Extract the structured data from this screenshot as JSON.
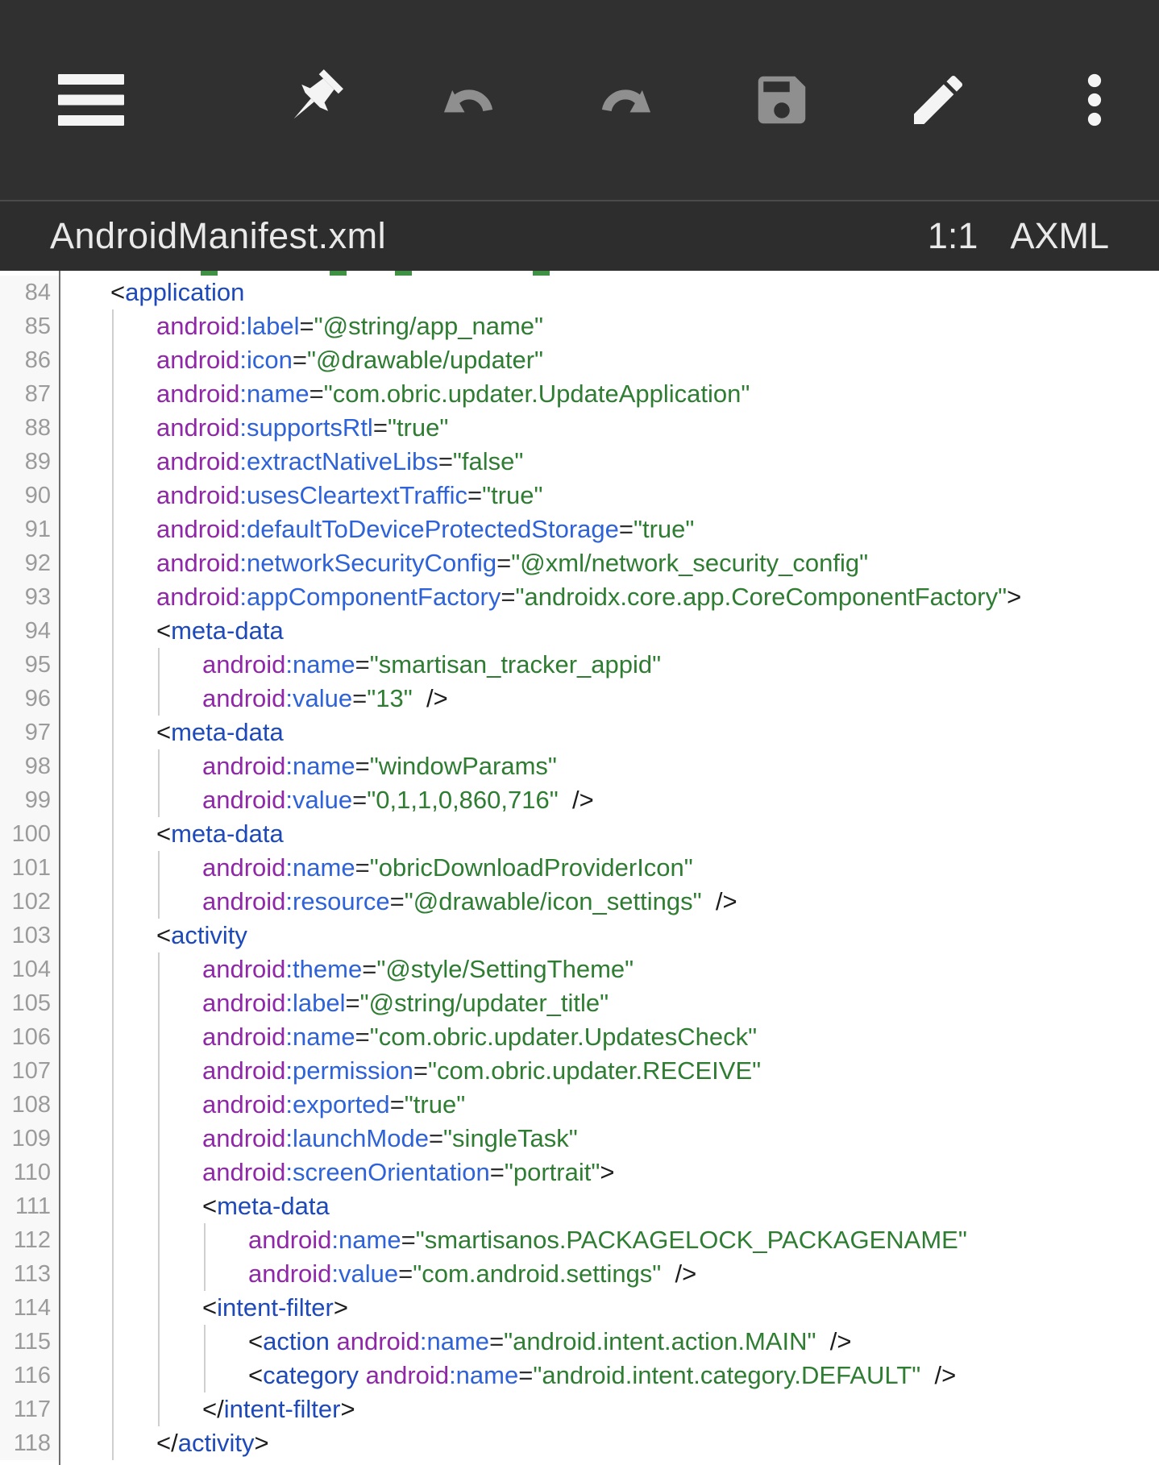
{
  "colors": {
    "toolbar_bg": "#303030",
    "titlebar_bg": "#2d2d2d",
    "tag_blue": "#1d49bb",
    "attr_blue": "#2e62d8",
    "namespace_purple": "#8f27a8",
    "string_green": "#2e7d32",
    "punct_black": "#1c1c1c",
    "line_number_gray": "#9b9b9b"
  },
  "toolbar": {
    "buttons": [
      {
        "id": "menu",
        "icon": "hamburger-menu-icon",
        "enabled": true
      },
      {
        "id": "pin",
        "icon": "pushpin-icon",
        "enabled": true
      },
      {
        "id": "undo",
        "icon": "undo-icon",
        "enabled": false
      },
      {
        "id": "redo",
        "icon": "redo-icon",
        "enabled": false
      },
      {
        "id": "save",
        "icon": "save-icon",
        "enabled": false
      },
      {
        "id": "edit",
        "icon": "edit-pencil-icon",
        "enabled": true
      },
      {
        "id": "more",
        "icon": "more-vert-icon",
        "enabled": true
      }
    ]
  },
  "titlebar": {
    "filename": "AndroidManifest.xml",
    "cursor_position": "1:1",
    "format": "AXML"
  },
  "editor": {
    "clipped_marks": [
      249,
      409,
      490,
      661
    ],
    "guides": [
      {
        "level": 1,
        "from": 85,
        "to": 118
      },
      {
        "level": 2,
        "from": 95,
        "to": 96
      },
      {
        "level": 2,
        "from": 98,
        "to": 99
      },
      {
        "level": 2,
        "from": 101,
        "to": 102
      },
      {
        "level": 2,
        "from": 104,
        "to": 117
      },
      {
        "level": 3,
        "from": 112,
        "to": 113
      },
      {
        "level": 3,
        "from": 115,
        "to": 116
      }
    ],
    "lines": [
      {
        "n": 84,
        "d": 1,
        "s": [
          [
            "pt",
            "<"
          ],
          [
            "tg",
            "application"
          ]
        ]
      },
      {
        "n": 85,
        "d": 2,
        "s": [
          [
            "ns",
            "android"
          ],
          [
            "at",
            ":label"
          ],
          [
            "eq",
            "="
          ],
          [
            "st",
            "\"@string/app_name\""
          ]
        ]
      },
      {
        "n": 86,
        "d": 2,
        "s": [
          [
            "ns",
            "android"
          ],
          [
            "at",
            ":icon"
          ],
          [
            "eq",
            "="
          ],
          [
            "st",
            "\"@drawable/updater\""
          ]
        ]
      },
      {
        "n": 87,
        "d": 2,
        "s": [
          [
            "ns",
            "android"
          ],
          [
            "at",
            ":name"
          ],
          [
            "eq",
            "="
          ],
          [
            "st",
            "\"com.obric.updater.UpdateApplication\""
          ]
        ]
      },
      {
        "n": 88,
        "d": 2,
        "s": [
          [
            "ns",
            "android"
          ],
          [
            "at",
            ":supportsRtl"
          ],
          [
            "eq",
            "="
          ],
          [
            "st",
            "\"true\""
          ]
        ]
      },
      {
        "n": 89,
        "d": 2,
        "s": [
          [
            "ns",
            "android"
          ],
          [
            "at",
            ":extractNativeLibs"
          ],
          [
            "eq",
            "="
          ],
          [
            "st",
            "\"false\""
          ]
        ]
      },
      {
        "n": 90,
        "d": 2,
        "s": [
          [
            "ns",
            "android"
          ],
          [
            "at",
            ":usesCleartextTraffic"
          ],
          [
            "eq",
            "="
          ],
          [
            "st",
            "\"true\""
          ]
        ]
      },
      {
        "n": 91,
        "d": 2,
        "s": [
          [
            "ns",
            "android"
          ],
          [
            "at",
            ":defaultToDeviceProtectedStorage"
          ],
          [
            "eq",
            "="
          ],
          [
            "st",
            "\"true\""
          ]
        ]
      },
      {
        "n": 92,
        "d": 2,
        "s": [
          [
            "ns",
            "android"
          ],
          [
            "at",
            ":networkSecurityConfig"
          ],
          [
            "eq",
            "="
          ],
          [
            "st",
            "\"@xml/network_security_config\""
          ]
        ]
      },
      {
        "n": 93,
        "d": 2,
        "s": [
          [
            "ns",
            "android"
          ],
          [
            "at",
            ":appComponentFactory"
          ],
          [
            "eq",
            "="
          ],
          [
            "st",
            "\"androidx.core.app.CoreComponentFactory\""
          ],
          [
            "pt",
            ">"
          ]
        ]
      },
      {
        "n": 94,
        "d": 2,
        "s": [
          [
            "pt",
            "<"
          ],
          [
            "tg",
            "meta-data"
          ]
        ]
      },
      {
        "n": 95,
        "d": 3,
        "s": [
          [
            "ns",
            "android"
          ],
          [
            "at",
            ":name"
          ],
          [
            "eq",
            "="
          ],
          [
            "st",
            "\"smartisan_tracker_appid\""
          ]
        ]
      },
      {
        "n": 96,
        "d": 3,
        "s": [
          [
            "ns",
            "android"
          ],
          [
            "at",
            ":value"
          ],
          [
            "eq",
            "="
          ],
          [
            "st",
            "\"13\""
          ],
          [
            "pt",
            "  />"
          ]
        ]
      },
      {
        "n": 97,
        "d": 2,
        "s": [
          [
            "pt",
            "<"
          ],
          [
            "tg",
            "meta-data"
          ]
        ]
      },
      {
        "n": 98,
        "d": 3,
        "s": [
          [
            "ns",
            "android"
          ],
          [
            "at",
            ":name"
          ],
          [
            "eq",
            "="
          ],
          [
            "st",
            "\"windowParams\""
          ]
        ]
      },
      {
        "n": 99,
        "d": 3,
        "s": [
          [
            "ns",
            "android"
          ],
          [
            "at",
            ":value"
          ],
          [
            "eq",
            "="
          ],
          [
            "st",
            "\"0,1,1,0,860,716\""
          ],
          [
            "pt",
            "  />"
          ]
        ]
      },
      {
        "n": 100,
        "d": 2,
        "s": [
          [
            "pt",
            "<"
          ],
          [
            "tg",
            "meta-data"
          ]
        ]
      },
      {
        "n": 101,
        "d": 3,
        "s": [
          [
            "ns",
            "android"
          ],
          [
            "at",
            ":name"
          ],
          [
            "eq",
            "="
          ],
          [
            "st",
            "\"obricDownloadProviderIcon\""
          ]
        ]
      },
      {
        "n": 102,
        "d": 3,
        "s": [
          [
            "ns",
            "android"
          ],
          [
            "at",
            ":resource"
          ],
          [
            "eq",
            "="
          ],
          [
            "st",
            "\"@drawable/icon_settings\""
          ],
          [
            "pt",
            "  />"
          ]
        ]
      },
      {
        "n": 103,
        "d": 2,
        "s": [
          [
            "pt",
            "<"
          ],
          [
            "tg",
            "activity"
          ]
        ]
      },
      {
        "n": 104,
        "d": 3,
        "s": [
          [
            "ns",
            "android"
          ],
          [
            "at",
            ":theme"
          ],
          [
            "eq",
            "="
          ],
          [
            "st",
            "\"@style/SettingTheme\""
          ]
        ]
      },
      {
        "n": 105,
        "d": 3,
        "s": [
          [
            "ns",
            "android"
          ],
          [
            "at",
            ":label"
          ],
          [
            "eq",
            "="
          ],
          [
            "st",
            "\"@string/updater_title\""
          ]
        ]
      },
      {
        "n": 106,
        "d": 3,
        "s": [
          [
            "ns",
            "android"
          ],
          [
            "at",
            ":name"
          ],
          [
            "eq",
            "="
          ],
          [
            "st",
            "\"com.obric.updater.UpdatesCheck\""
          ]
        ]
      },
      {
        "n": 107,
        "d": 3,
        "s": [
          [
            "ns",
            "android"
          ],
          [
            "at",
            ":permission"
          ],
          [
            "eq",
            "="
          ],
          [
            "st",
            "\"com.obric.updater.RECEIVE\""
          ]
        ]
      },
      {
        "n": 108,
        "d": 3,
        "s": [
          [
            "ns",
            "android"
          ],
          [
            "at",
            ":exported"
          ],
          [
            "eq",
            "="
          ],
          [
            "st",
            "\"true\""
          ]
        ]
      },
      {
        "n": 109,
        "d": 3,
        "s": [
          [
            "ns",
            "android"
          ],
          [
            "at",
            ":launchMode"
          ],
          [
            "eq",
            "="
          ],
          [
            "st",
            "\"singleTask\""
          ]
        ]
      },
      {
        "n": 110,
        "d": 3,
        "s": [
          [
            "ns",
            "android"
          ],
          [
            "at",
            ":screenOrientation"
          ],
          [
            "eq",
            "="
          ],
          [
            "st",
            "\"portrait\""
          ],
          [
            "pt",
            ">"
          ]
        ]
      },
      {
        "n": 111,
        "d": 3,
        "s": [
          [
            "pt",
            "<"
          ],
          [
            "tg",
            "meta-data"
          ]
        ]
      },
      {
        "n": 112,
        "d": 4,
        "s": [
          [
            "ns",
            "android"
          ],
          [
            "at",
            ":name"
          ],
          [
            "eq",
            "="
          ],
          [
            "st",
            "\"smartisanos.PACKAGELOCK_PACKAGENAME\""
          ]
        ]
      },
      {
        "n": 113,
        "d": 4,
        "s": [
          [
            "ns",
            "android"
          ],
          [
            "at",
            ":value"
          ],
          [
            "eq",
            "="
          ],
          [
            "st",
            "\"com.android.settings\""
          ],
          [
            "pt",
            "  />"
          ]
        ]
      },
      {
        "n": 114,
        "d": 3,
        "s": [
          [
            "pt",
            "<"
          ],
          [
            "tg",
            "intent-filter"
          ],
          [
            "pt",
            ">"
          ]
        ]
      },
      {
        "n": 115,
        "d": 4,
        "s": [
          [
            "pt",
            "<"
          ],
          [
            "tg",
            "action"
          ],
          [
            "pt",
            " "
          ],
          [
            "ns",
            "android"
          ],
          [
            "at",
            ":name"
          ],
          [
            "eq",
            "="
          ],
          [
            "st",
            "\"android.intent.action.MAIN\""
          ],
          [
            "pt",
            "  />"
          ]
        ]
      },
      {
        "n": 116,
        "d": 4,
        "s": [
          [
            "pt",
            "<"
          ],
          [
            "tg",
            "category"
          ],
          [
            "pt",
            " "
          ],
          [
            "ns",
            "android"
          ],
          [
            "at",
            ":name"
          ],
          [
            "eq",
            "="
          ],
          [
            "st",
            "\"android.intent.category.DEFAULT\""
          ],
          [
            "pt",
            "  />"
          ]
        ]
      },
      {
        "n": 117,
        "d": 3,
        "s": [
          [
            "pt",
            "</"
          ],
          [
            "tg",
            "intent-filter"
          ],
          [
            "pt",
            ">"
          ]
        ]
      },
      {
        "n": 118,
        "d": 2,
        "s": [
          [
            "pt",
            "</"
          ],
          [
            "tg",
            "activity"
          ],
          [
            "pt",
            ">"
          ]
        ]
      }
    ]
  }
}
